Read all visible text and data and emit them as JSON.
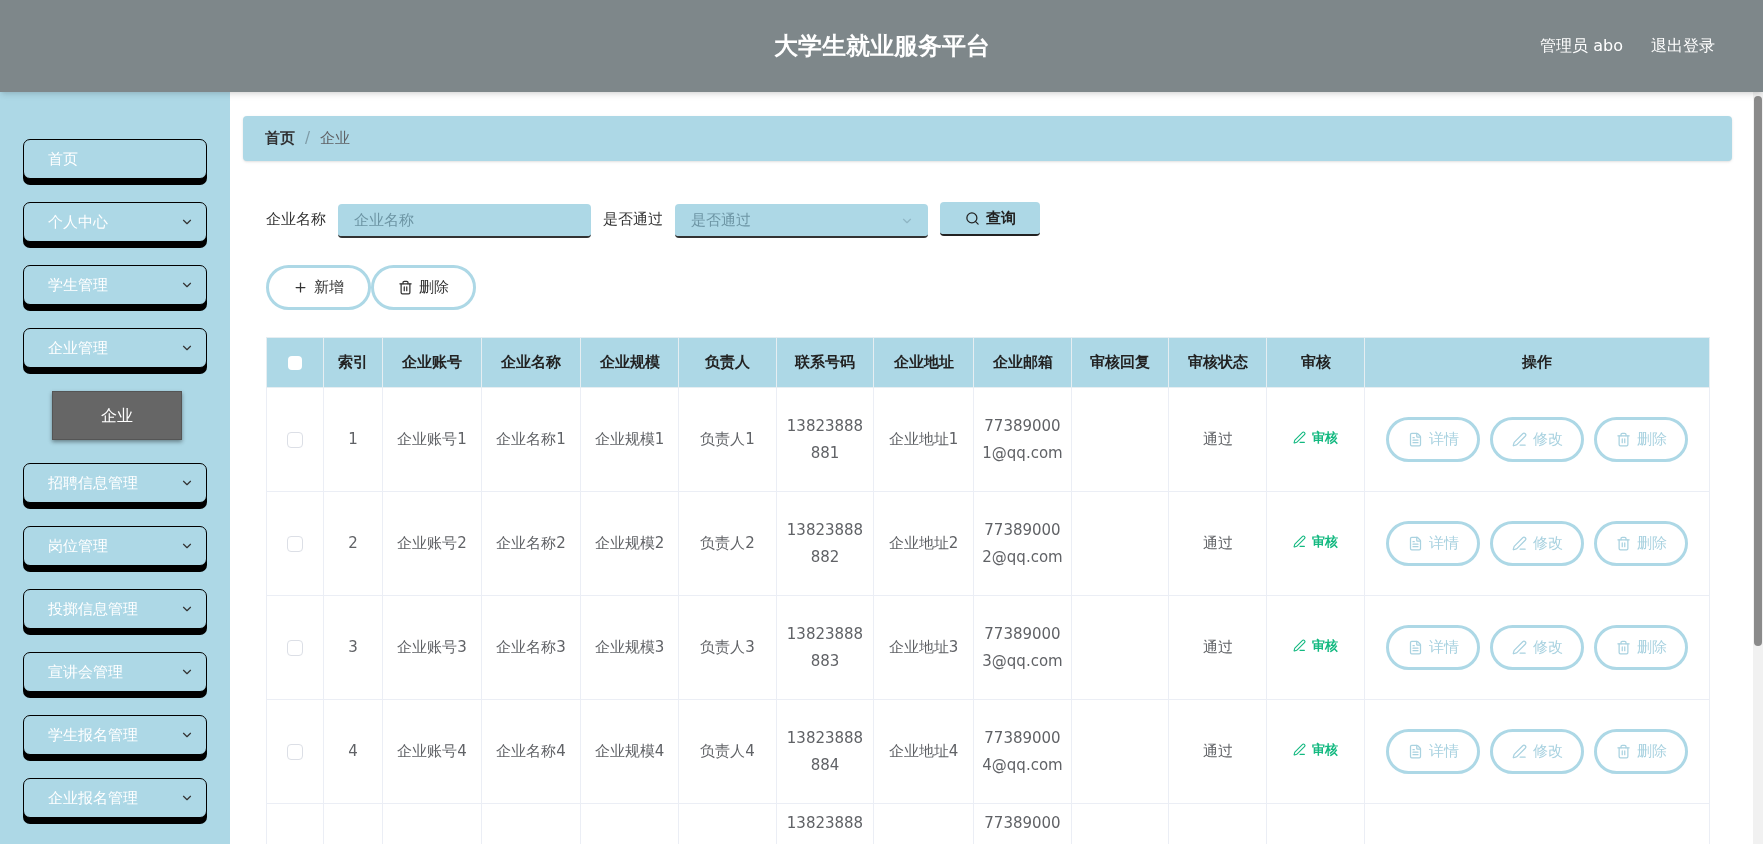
{
  "header": {
    "title": "大学生就业服务平台",
    "user": "管理员 abo",
    "logout": "退出登录"
  },
  "sidebar": {
    "items": [
      {
        "label": "首页",
        "expandable": false
      },
      {
        "label": "个人中心",
        "expandable": true
      },
      {
        "label": "学生管理",
        "expandable": true
      },
      {
        "label": "企业管理",
        "expandable": true,
        "children": [
          {
            "label": "企业",
            "selected": true
          }
        ]
      },
      {
        "label": "招聘信息管理",
        "expandable": true
      },
      {
        "label": "岗位管理",
        "expandable": true
      },
      {
        "label": "投掷信息管理",
        "expandable": true
      },
      {
        "label": "宣讲会管理",
        "expandable": true
      },
      {
        "label": "学生报名管理",
        "expandable": true
      },
      {
        "label": "企业报名管理",
        "expandable": true
      }
    ]
  },
  "breadcrumb": {
    "separator": "/",
    "items": [
      "首页",
      "企业"
    ]
  },
  "filters": [
    {
      "label": "企业名称",
      "kind": "input",
      "placeholder": "企业名称"
    },
    {
      "label": "是否通过",
      "kind": "select",
      "placeholder": "是否通过"
    }
  ],
  "search_button": "查询",
  "toolbar": [
    {
      "label": "新增",
      "kind": "add"
    },
    {
      "label": "删除",
      "kind": "delete"
    }
  ],
  "table": {
    "select_all_checked": false,
    "columns": [
      "索引",
      "企业账号",
      "企业名称",
      "企业规模",
      "负责人",
      "联系号码",
      "企业地址",
      "企业邮箱",
      "审核回复",
      "审核状态",
      "审核",
      "操作"
    ],
    "rows": [
      {
        "checked": false,
        "cells": [
          "1",
          "企业账号1",
          "企业名称1",
          "企业规模1",
          "负责人1",
          "13823888881",
          "企业地址1",
          "773890001@qq.com",
          "",
          "通过"
        ],
        "review": "审核",
        "actions": [
          {
            "label": "详情",
            "kind": "detail"
          },
          {
            "label": "修改",
            "kind": "edit"
          },
          {
            "label": "删除",
            "kind": "delete"
          }
        ]
      },
      {
        "checked": false,
        "cells": [
          "2",
          "企业账号2",
          "企业名称2",
          "企业规模2",
          "负责人2",
          "13823888882",
          "企业地址2",
          "773890002@qq.com",
          "",
          "通过"
        ],
        "review": "审核",
        "actions": [
          {
            "label": "详情",
            "kind": "detail"
          },
          {
            "label": "修改",
            "kind": "edit"
          },
          {
            "label": "删除",
            "kind": "delete"
          }
        ]
      },
      {
        "checked": false,
        "cells": [
          "3",
          "企业账号3",
          "企业名称3",
          "企业规模3",
          "负责人3",
          "13823888883",
          "企业地址3",
          "773890003@qq.com",
          "",
          "通过"
        ],
        "review": "审核",
        "actions": [
          {
            "label": "详情",
            "kind": "detail"
          },
          {
            "label": "修改",
            "kind": "edit"
          },
          {
            "label": "删除",
            "kind": "delete"
          }
        ]
      },
      {
        "checked": false,
        "cells": [
          "4",
          "企业账号4",
          "企业名称4",
          "企业规模4",
          "负责人4",
          "13823888884",
          "企业地址4",
          "773890004@qq.com",
          "",
          "通过"
        ],
        "review": "审核",
        "actions": [
          {
            "label": "详情",
            "kind": "detail"
          },
          {
            "label": "修改",
            "kind": "edit"
          },
          {
            "label": "删除",
            "kind": "delete"
          }
        ]
      },
      {
        "cells": [
          "",
          "",
          "",
          "",
          "",
          "13823888",
          "",
          "77389000",
          "",
          ""
        ]
      }
    ]
  }
}
